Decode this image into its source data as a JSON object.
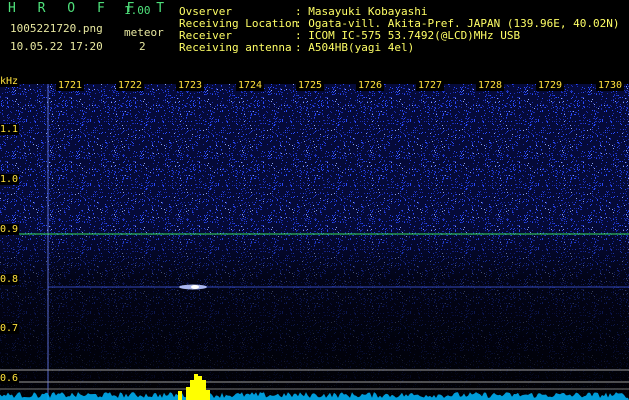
{
  "app": {
    "title": "H R O F F T",
    "version": "1.00",
    "filename": "1005221720.png",
    "datetime": "10.05.22 17:20",
    "meteor_label": "meteor",
    "meteor_count": "2"
  },
  "info": [
    {
      "key": "Ovserver",
      "value": ": Masayuki Kobayashi"
    },
    {
      "key": "Receiving Location",
      "value": ": Ogata-vill. Akita-Pref. JAPAN (139.96E, 40.02N)"
    },
    {
      "key": "Receiver",
      "value": ": ICOM IC-575 53.7492(@LCD)MHz USB"
    },
    {
      "key": "Receiving antenna",
      "value": ": A504HB(yagi 4el)"
    }
  ],
  "spectrogram": {
    "y_unit": "kHz",
    "x_ticks": [
      "1721",
      "1722",
      "1723",
      "1724",
      "1725",
      "1726",
      "1727",
      "1728",
      "1729",
      "1730"
    ],
    "y_ticks": [
      "1.1",
      "1.0",
      "0.9",
      "0.8",
      "0.7",
      "0.6"
    ],
    "colors": {
      "noise": "#2a4cff",
      "background": "#000000",
      "ref_line": "#35e05a",
      "meteor": "#ffffff",
      "signal": "#ffff00",
      "floor": "#00b7ff"
    }
  }
}
